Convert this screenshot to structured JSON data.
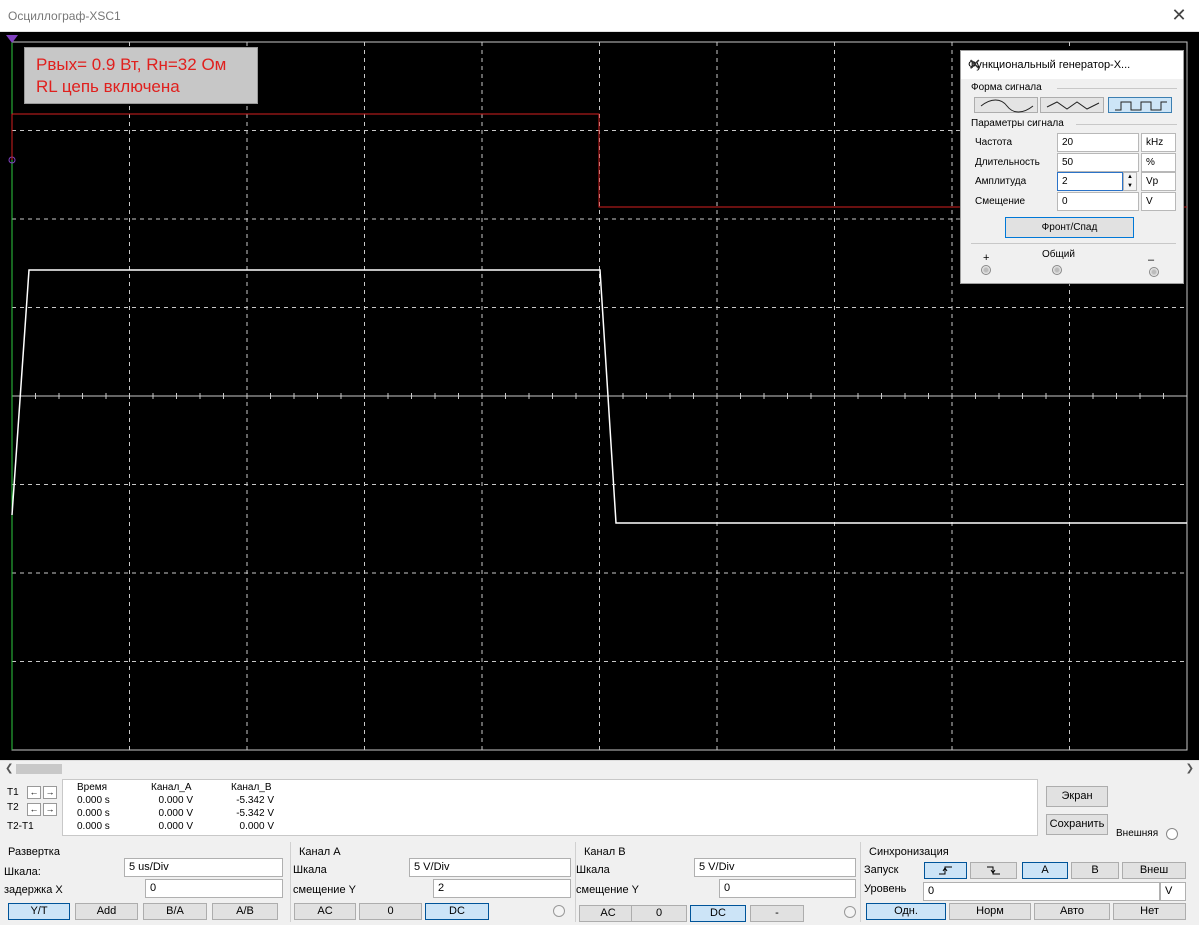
{
  "window": {
    "title": "Осциллограф-XSC1",
    "close_symbol": "✕"
  },
  "annotation": {
    "line1": "Рвых= 0.9 Вт, Rн=32 Ом",
    "line2": "RL цепь включена"
  },
  "colors": {
    "screen_bg": "#000000",
    "grid": "#c8c8c8",
    "channel_a": "#ffffff",
    "channel_b": "#d42020",
    "cursor_t1": "#2ecc40",
    "cursor_t2": "#8040c0",
    "annotation_text": "#e0201e"
  },
  "function_generator": {
    "title": "Функциональный генератор-X...",
    "close_symbol": "✕",
    "waveform_label": "Форма сигнала",
    "waveforms": [
      {
        "name": "sine",
        "active": false
      },
      {
        "name": "triangle",
        "active": false
      },
      {
        "name": "square",
        "active": true
      }
    ],
    "params_label": "Параметры сигнала",
    "params": [
      {
        "label": "Частота",
        "value": "20",
        "unit": "kHz"
      },
      {
        "label": "Длительность",
        "value": "50",
        "unit": "%"
      },
      {
        "label": "Амплитуда",
        "value": "2",
        "unit": "Vp"
      },
      {
        "label": "Смещение",
        "value": "0",
        "unit": "V"
      }
    ],
    "edge_button": "Фронт/Спад",
    "terminals": {
      "plus": "+",
      "common": "Общий",
      "minus": "–"
    }
  },
  "cursors": {
    "labels": [
      "T1",
      "T2",
      "T2-T1"
    ],
    "left_arrow": "←",
    "right_arrow": "→"
  },
  "readout": {
    "headers": [
      "Время",
      "Канал_A",
      "Канал_B"
    ],
    "rows": [
      [
        "0.000 s",
        "0.000 V",
        "-5.342 V"
      ],
      [
        "0.000 s",
        "0.000 V",
        "-5.342 V"
      ],
      [
        "0.000 s",
        "0.000 V",
        "0.000 V"
      ]
    ]
  },
  "side_buttons": {
    "screen": "Экран",
    "save": "Сохранить",
    "external": "Внешняя"
  },
  "timebase": {
    "title": "Развертка",
    "scale_label": "Шкала:",
    "scale_value": "5 us/Div",
    "delay_label": "задержка X",
    "delay_value": "0",
    "modes": [
      {
        "label": "Y/T",
        "active": true
      },
      {
        "label": "Add",
        "active": false
      },
      {
        "label": "B/A",
        "active": false
      },
      {
        "label": "A/B",
        "active": false
      }
    ]
  },
  "channel_a": {
    "title": "Канал A",
    "scale_label": "Шкала",
    "scale_value": "5  V/Div",
    "offset_label": "смещение Y",
    "offset_value": "2",
    "coupling": [
      {
        "label": "AC",
        "active": false
      },
      {
        "label": "0",
        "active": false
      },
      {
        "label": "DC",
        "active": true
      }
    ]
  },
  "channel_b": {
    "title": "Канал B",
    "scale_label": "Шкала",
    "scale_value": "5  V/Div",
    "offset_label": "смещение Y",
    "offset_value": "0",
    "coupling": [
      {
        "label": "AC",
        "active": false
      },
      {
        "label": "0",
        "active": false
      },
      {
        "label": "DC",
        "active": true
      },
      {
        "label": "-",
        "active": false
      }
    ]
  },
  "trigger": {
    "title": "Синхронизация",
    "edge_label": "Запуск",
    "edges": [
      {
        "name": "rising-edge",
        "active": true
      },
      {
        "name": "falling-edge",
        "active": false
      }
    ],
    "sources": [
      {
        "label": "A",
        "active": true
      },
      {
        "label": "B",
        "active": false
      },
      {
        "label": "Внеш",
        "active": false
      }
    ],
    "level_label": "Уровень",
    "level_value": "0",
    "level_unit": "V",
    "modes": [
      {
        "label": "Одн.",
        "active": true
      },
      {
        "label": "Норм",
        "active": false
      },
      {
        "label": "Авто",
        "active": false
      },
      {
        "label": "Нет",
        "active": false
      }
    ]
  }
}
